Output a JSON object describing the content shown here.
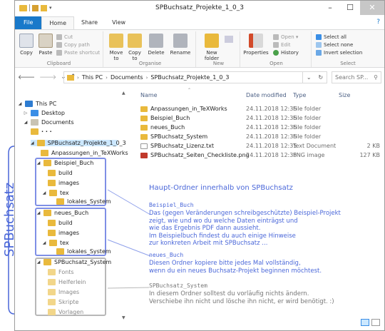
{
  "window": {
    "title": "SPBuchsatz_Projekte_1_0_3"
  },
  "window_buttons": {
    "minimize": "–",
    "maximize": "☐",
    "close": "✕"
  },
  "tabs": [
    {
      "label": "File",
      "kind": "file"
    },
    {
      "label": "Home",
      "kind": "active"
    },
    {
      "label": "Share",
      "kind": "normal"
    },
    {
      "label": "View",
      "kind": "normal"
    }
  ],
  "help": "?",
  "ribbon": {
    "clipboard": {
      "group": "Clipboard",
      "copy": "Copy",
      "paste": "Paste",
      "cut": "Cut",
      "copy_path": "Copy path",
      "paste_shortcut": "Paste shortcut"
    },
    "organise": {
      "group": "Organise",
      "move_to": "Move to",
      "copy_to": "Copy to",
      "delete": "Delete",
      "rename": "Rename"
    },
    "new": {
      "group": "New",
      "new_folder": "New folder"
    },
    "open": {
      "group": "Open",
      "properties": "Properties",
      "open": "Open ▾",
      "edit": "Edit",
      "history": "History"
    },
    "select": {
      "group": "Select",
      "select_all": "Select all",
      "select_none": "Select none",
      "invert": "Invert selection"
    }
  },
  "nav": {
    "back": "🡐",
    "forward": "🡒",
    "recent": "⌄",
    "up": "↑",
    "crumbs": [
      "This PC",
      "Documents",
      "SPBuchsatz_Projekte_1_0_3"
    ],
    "search_placeholder": "Search SP...",
    "refresh": "↻"
  },
  "tree": {
    "this_pc": "This PC",
    "desktop": "Desktop",
    "documents": "Documents",
    "dots": "· · ·",
    "root": "SPBuchsatz_Projekte_1_0_3",
    "anpassungen": "Anpassungen_in_TeXWorks",
    "beispiel": "Beispiel_Buch",
    "neues": "neues_Buch",
    "system": "SPBuchsatz_System",
    "build": "build",
    "images": "images",
    "tex": "tex",
    "lokales": "lokales_System",
    "fonts": "Fonts",
    "helferlein": "Helferlein",
    "images2": "Images",
    "skripte": "Skripte",
    "vorlagen": "Vorlagen"
  },
  "columns": {
    "name": "Name",
    "date": "Date modified",
    "type": "Type",
    "size": "Size"
  },
  "files": [
    {
      "name": "Anpassungen_in_TeXWorks",
      "date": "24.11.2018 12:35",
      "type": "File folder",
      "size": "",
      "kind": "folder"
    },
    {
      "name": "Beispiel_Buch",
      "date": "24.11.2018 12:35",
      "type": "File folder",
      "size": "",
      "kind": "folder"
    },
    {
      "name": "neues_Buch",
      "date": "24.11.2018 12:35",
      "type": "File folder",
      "size": "",
      "kind": "folder"
    },
    {
      "name": "SPBuchsatz_System",
      "date": "24.11.2018 12:35",
      "type": "File folder",
      "size": "",
      "kind": "folder"
    },
    {
      "name": "SPBuchsatz_Lizenz.txt",
      "date": "24.11.2018 12:35",
      "type": "Text Document",
      "size": "2 KB",
      "kind": "txt"
    },
    {
      "name": "SPBuchsatz_Seiten_Checkliste.png",
      "date": "24.11.2018 12:35",
      "type": "PNG image",
      "size": "127 KB",
      "kind": "png"
    }
  ],
  "annotations": {
    "haupt": "Haupt-Ordner innerhalb von SPBuchsatz",
    "beispiel_title": "Beispiel_Buch",
    "beispiel_lines": [
      "Das (gegen Veränderungen schreibgeschützte) Beispiel-Projekt",
      "zeigt, wie und wo du welche Daten einträgst und",
      "wie das Ergebnis PDF dann aussieht.",
      "Im Beispielbuch findest du auch einige Hinweise",
      "zur konkreten Arbeit mit SPBuchsatz ..."
    ],
    "neues_title": "neues_Buch",
    "neues_lines": [
      "Diesen Ordner kopiere bitte jedes Mal vollständig,",
      "wenn du ein neues Buchsatz-Projekt beginnen möchtest."
    ],
    "system_title": "SPBuchsatz_System",
    "system_lines": [
      "In diesem Ordner solltest du vorläufig nichts ändern.",
      "Verschiebe ihn nicht und lösche ihn nicht, er wird benötigt. :)"
    ]
  },
  "side_label": "SPBuchsatz",
  "colors": {
    "accent": "#1979ca",
    "annotation_blue": "#4a67d9",
    "folder": "#e9b93c",
    "selection": "#cce8ff"
  }
}
